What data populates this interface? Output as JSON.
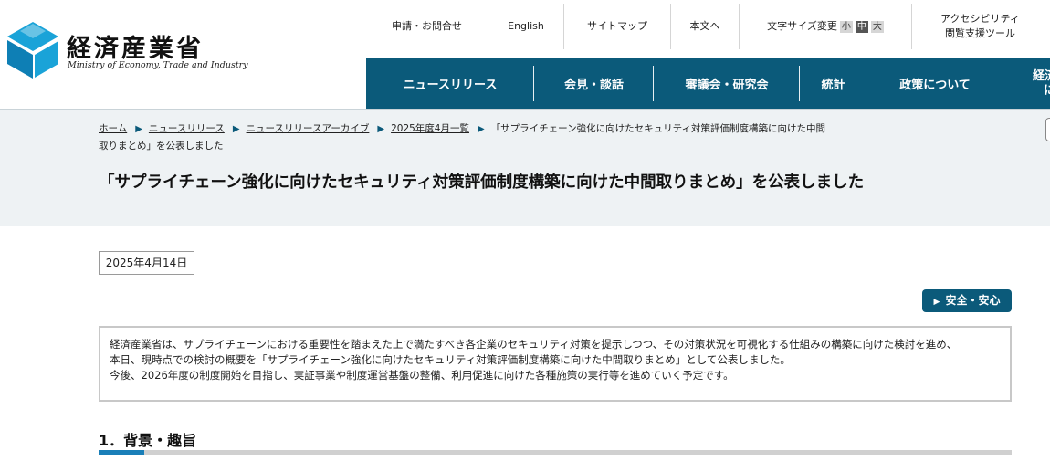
{
  "header": {
    "logo_title": "経済産業省",
    "logo_subtitle": "Ministry of Economy, Trade and Industry",
    "util_links": [
      {
        "label": "申請・お問合せ"
      },
      {
        "label": "English"
      },
      {
        "label": "サイトマップ"
      },
      {
        "label": "本文へ"
      }
    ],
    "font_size": {
      "label": "文字サイズ変更",
      "small": "小",
      "medium": "中",
      "large": "大",
      "selected": "中"
    },
    "accessibility": {
      "line1": "アクセシビリティ",
      "line2": "閲覧支援ツール"
    },
    "global_nav": [
      {
        "label": "ニュースリリース"
      },
      {
        "label": "会見・談話"
      },
      {
        "label": "審議会・研究会"
      },
      {
        "label": "統計"
      },
      {
        "label": "政策について"
      },
      {
        "label": "経済",
        "label2": "に"
      }
    ]
  },
  "breadcrumb": {
    "items": [
      "ホーム",
      "ニュースリリース",
      "ニュースリリースアーカイブ",
      "2025年度4月一覧"
    ],
    "separator": "▶",
    "current": "「サプライチェーン強化に向けたセキュリティ対策評価制度構築に向けた中間取りまとめ」を公表しました"
  },
  "page_title": "「サプライチェーン強化に向けたセキュリティ対策評価制度構築に向けた中間取りまとめ」を公表しました",
  "date": "2025年4月14日",
  "tag_button": {
    "arrow": "▶",
    "label": "安全・安心"
  },
  "summary": {
    "line1": "経済産業省は、サプライチェーンにおける重要性を踏まえた上で満たすべき各企業のセキュリティ対策を提示しつつ、その対策状況を可視化する仕組みの構築に向けた検討を進め、",
    "line2": "本日、現時点での検討の概要を「サプライチェーン強化に向けたセキュリティ対策評価制度構築に向けた中間取りまとめ」として公表しました。",
    "line3": "今後、2026年度の制度開始を目指し、実証事業や制度運営基盤の整備、利用促進に向けた各種施策の実行等を進めていく予定です。"
  },
  "section_heading": "1．背景・趣旨",
  "colors": {
    "brand": "#0b5a7a",
    "band": "#eef2f4",
    "accent": "#1a7fb8"
  }
}
